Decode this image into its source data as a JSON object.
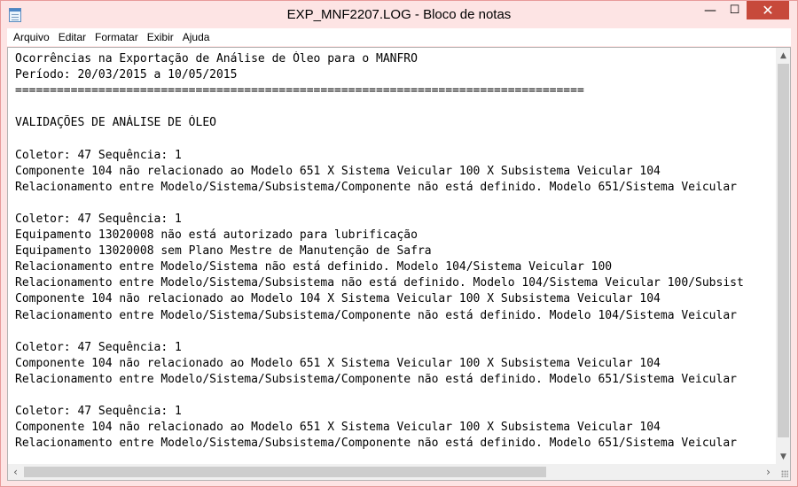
{
  "window": {
    "title": "EXP_MNF2207.LOG - Bloco de notas",
    "controls": {
      "minimize": "—",
      "maximize": "☐",
      "close": "✕"
    },
    "colors": {
      "titlebar": "#fde4e4",
      "close_button": "#c7493b"
    }
  },
  "menu": {
    "items": [
      {
        "label": "Arquivo"
      },
      {
        "label": "Editar"
      },
      {
        "label": "Formatar"
      },
      {
        "label": "Exibir"
      },
      {
        "label": "Ajuda"
      }
    ]
  },
  "document": {
    "lines": [
      "Ocorrências na Exportação de Análise de Óleo para o MANFRO",
      "Período: 20/03/2015 a 10/05/2015",
      "==================================================================================",
      "",
      "VALIDAÇÕES DE ANÁLISE DE ÓLEO",
      "",
      "Coletor: 47 Sequência: 1",
      "Componente 104 não relacionado ao Modelo 651 X Sistema Veicular 100 X Subsistema Veicular 104",
      "Relacionamento entre Modelo/Sistema/Subsistema/Componente não está definido. Modelo 651/Sistema Veicular",
      "",
      "Coletor: 47 Sequência: 1",
      "Equipamento 13020008 não está autorizado para lubrificação",
      "Equipamento 13020008 sem Plano Mestre de Manutenção de Safra",
      "Relacionamento entre Modelo/Sistema não está definido. Modelo 104/Sistema Veicular 100",
      "Relacionamento entre Modelo/Sistema/Subsistema não está definido. Modelo 104/Sistema Veicular 100/Subsist",
      "Componente 104 não relacionado ao Modelo 104 X Sistema Veicular 100 X Subsistema Veicular 104",
      "Relacionamento entre Modelo/Sistema/Subsistema/Componente não está definido. Modelo 104/Sistema Veicular",
      "",
      "Coletor: 47 Sequência: 1",
      "Componente 104 não relacionado ao Modelo 651 X Sistema Veicular 100 X Subsistema Veicular 104",
      "Relacionamento entre Modelo/Sistema/Subsistema/Componente não está definido. Modelo 651/Sistema Veicular",
      "",
      "Coletor: 47 Sequência: 1",
      "Componente 104 não relacionado ao Modelo 651 X Sistema Veicular 100 X Subsistema Veicular 104",
      "Relacionamento entre Modelo/Sistema/Subsistema/Componente não está definido. Modelo 651/Sistema Veicular"
    ]
  },
  "scrollbars": {
    "vertical": {
      "up_icon": "up-arrow-icon",
      "down_icon": "down-arrow-icon"
    },
    "horizontal": {
      "left_icon": "left-arrow-icon",
      "right_icon": "right-arrow-icon"
    }
  }
}
